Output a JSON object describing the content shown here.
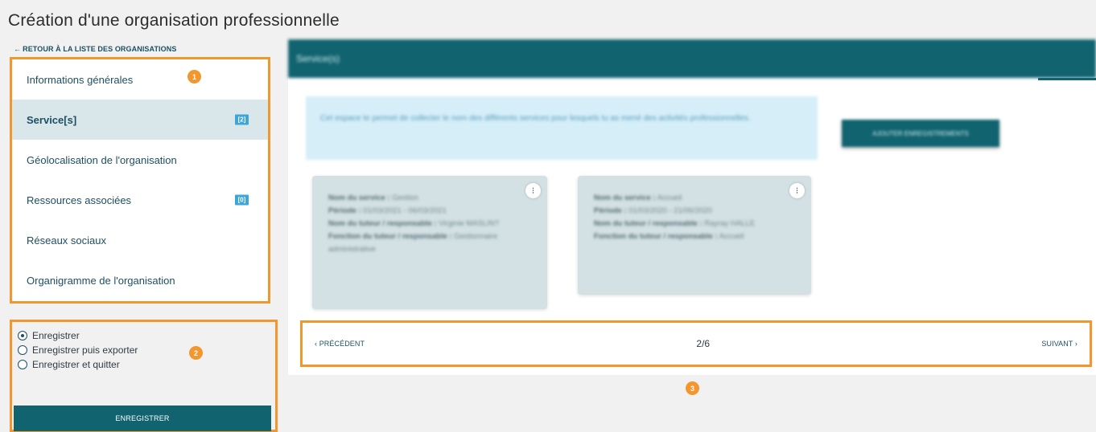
{
  "page": {
    "title": "Création d'une organisation professionnelle"
  },
  "back_link": {
    "arrow": "←",
    "label": "RETOUR À LA LISTE DES ORGANISATIONS"
  },
  "sidebar": {
    "items": [
      {
        "label": "Informations générales",
        "badge": null,
        "active": false
      },
      {
        "label": "Service[s]",
        "badge": "[2]",
        "active": true
      },
      {
        "label": "Géolocalisation de l'organisation",
        "badge": null,
        "active": false
      },
      {
        "label": "Ressources associées",
        "badge": "[0]",
        "active": false
      },
      {
        "label": "Réseaux sociaux",
        "badge": null,
        "active": false
      },
      {
        "label": "Organigramme de l'organisation",
        "badge": null,
        "active": false
      }
    ]
  },
  "markers": {
    "one": "1",
    "two": "2",
    "three": "3"
  },
  "save_panel": {
    "options": [
      {
        "label": "Enregistrer",
        "checked": true
      },
      {
        "label": "Enregistrer puis exporter",
        "checked": false
      },
      {
        "label": "Enregistrer et quitter",
        "checked": false
      }
    ],
    "button_label": "ENREGISTRER"
  },
  "main": {
    "header_title": "Service(s)",
    "info_text": "Cet espace te permet de collecter le nom des différents services pour lesquels tu as mené des activités professionnelles.",
    "add_button_label": "AJOUTER ENREGISTREMENTS",
    "card_menu_icon": "⁝",
    "cards": [
      {
        "lines": [
          {
            "label": "Nom du service :",
            "value": "Gestion"
          },
          {
            "label": "Période :",
            "value": "01/03/2021 - 06/03/2021"
          },
          {
            "label": "Nom du tuteur / responsable :",
            "value": "Virginie MASLIN?"
          },
          {
            "label": "Fonction du tuteur / responsable :",
            "value": "Gestionnaire administrative"
          }
        ]
      },
      {
        "lines": [
          {
            "label": "Nom du service :",
            "value": "Accueil"
          },
          {
            "label": "Période :",
            "value": "01/03/2020 - 21/06/2020"
          },
          {
            "label": "Nom du tuteur / responsable :",
            "value": "Rayray HALLE"
          },
          {
            "label": "Fonction du tuteur / responsable :",
            "value": "Accueil"
          }
        ]
      }
    ]
  },
  "pagination": {
    "prev_label": "‹ PRÉCÉDENT",
    "page": "2/6",
    "next_label": "SUIVANT ›"
  },
  "colors": {
    "accent": "#10636f",
    "highlight": "#f2962e",
    "badge": "#3aa6d9"
  }
}
